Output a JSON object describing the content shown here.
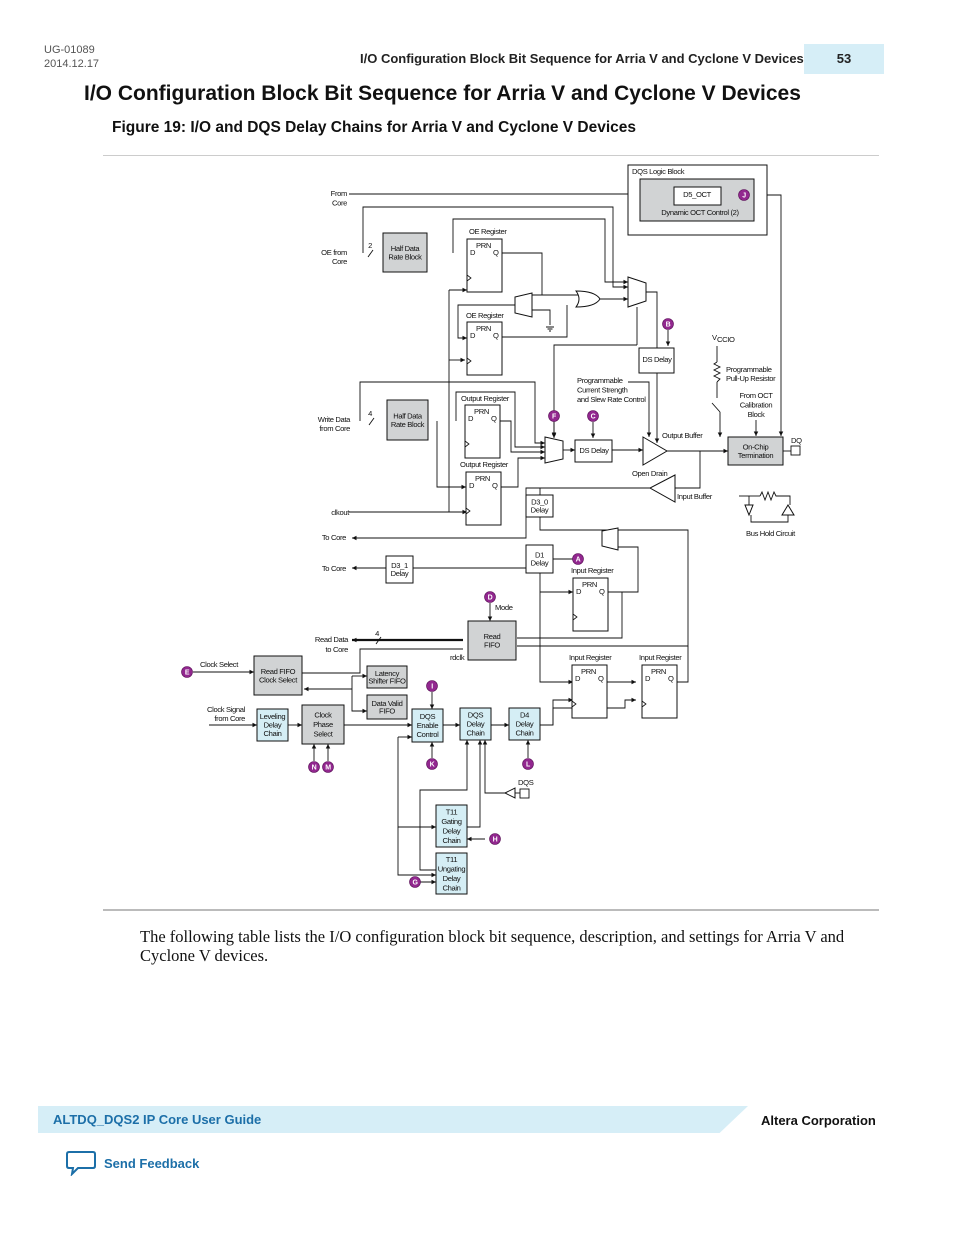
{
  "header": {
    "doc_id": "UG-01089",
    "date": "2014.12.17",
    "running_title": "I/O Configuration Block Bit Sequence for Arria V and Cyclone V Devices",
    "page_number": "53"
  },
  "heading": "I/O Configuration Block Bit Sequence for Arria V and Cyclone V Devices",
  "figure_title": "Figure 19: I/O and DQS Delay Chains for Arria V and Cyclone V Devices",
  "diagram": {
    "dqs_logic_block": "DQS Logic Block",
    "d5_oct": "D5_OCT",
    "dynamic_oct": "Dynamic OCT Control (2)",
    "from_core": [
      "From",
      "Core"
    ],
    "oe_from_core": [
      "OE from",
      "Core"
    ],
    "bus_2": "2",
    "bus_4": "4",
    "half_data_rate": [
      "Half Data",
      "Rate Block"
    ],
    "oe_register": "OE Register",
    "output_register": "Output Register",
    "input_register": "Input Register",
    "prn": "PRN",
    "d": "D",
    "q": "Q",
    "ds_delay": "DS Delay",
    "vccio": "V",
    "vccio_sub": "CCIO",
    "pullup": [
      "Programmable",
      "Pull-Up Resistor"
    ],
    "prog_current": [
      "Programmable",
      "Current Strength",
      "and Slew Rate Control"
    ],
    "from_oct": [
      "From OCT",
      "Calibration",
      "Block"
    ],
    "output_buffer": "Output Buffer",
    "on_chip_termination": [
      "On-Chip",
      "Termination"
    ],
    "dq": "DQ",
    "write_data": [
      "Write Data",
      "from Core"
    ],
    "open_drain": "Open Drain",
    "input_buffer": "Input Buffer",
    "clkout": "clkout",
    "d3_0": [
      "D3_0",
      "Delay"
    ],
    "bus_hold": "Bus Hold Circuit",
    "to_core": "To Core",
    "d3_1": [
      "D3_1",
      "Delay"
    ],
    "d1": [
      "D1",
      "Delay"
    ],
    "mode": "Mode",
    "read_data": [
      "Read Data",
      "to Core"
    ],
    "read_fifo": [
      "Read",
      "FIFO"
    ],
    "rdclk": "rdclk",
    "clock_select": "Clock Select",
    "read_fifo_clock_select": [
      "Read FIFO",
      "Clock Select"
    ],
    "latency_shifter": [
      "Latency",
      "Shifter FIFO"
    ],
    "data_valid": [
      "Data Valid",
      "FIFO"
    ],
    "clock_signal": [
      "Clock Signal",
      "from Core"
    ],
    "leveling": [
      "Leveling",
      "Delay",
      "Chain"
    ],
    "clock_phase_select": [
      "Clock",
      "Phase",
      "Select"
    ],
    "dqs_enable": [
      "DQS",
      "Enable",
      "Control"
    ],
    "dqs_delay_chain": [
      "DQS",
      "Delay",
      "Chain"
    ],
    "d4": [
      "D4",
      "Delay",
      "Chain"
    ],
    "dqs": "DQS",
    "t11_gating": [
      "T11",
      "Gating",
      "Delay",
      "Chain"
    ],
    "t11_ungating": [
      "T11",
      "Ungating",
      "Delay",
      "Chain"
    ],
    "markers": {
      "A": "A",
      "B": "B",
      "C": "C",
      "D": "D",
      "E": "E",
      "F": "F",
      "G": "G",
      "H": "H",
      "I": "I",
      "J": "J",
      "K": "K",
      "L": "L",
      "M": "M",
      "N": "N"
    },
    "colors": {
      "gray_block": "#d1d3d4",
      "blue_block": "#d5eef5",
      "marker": "#92278f"
    }
  },
  "paragraph": "The following table lists the I/O configuration block bit sequence, description, and settings for Arria V and Cyclone V devices.",
  "footer": {
    "guide": "ALTDQ_DQS2 IP Core User Guide",
    "company": "Altera Corporation",
    "feedback": "Send Feedback"
  }
}
